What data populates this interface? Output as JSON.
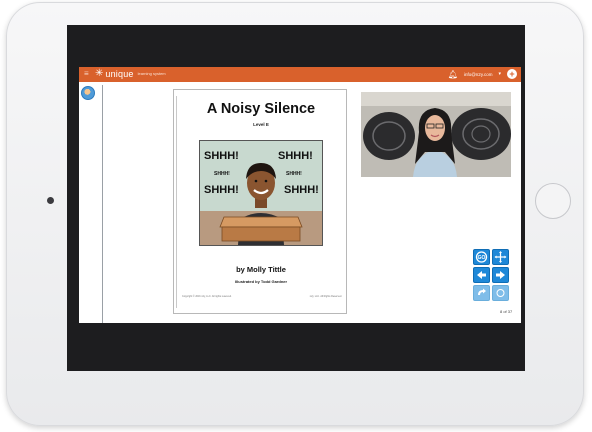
{
  "app": {
    "brand": "unique",
    "brand_sub": "learning system",
    "user_email": "info@n2y.com",
    "colors": {
      "topbar": "#d9612c",
      "control_blue": "#1e88d8"
    }
  },
  "book": {
    "title": "A Noisy Silence",
    "level": "Level E",
    "art_words": [
      "SHHH!",
      "SHHH!",
      "SHHH!",
      "SHHH!",
      "SHHH!",
      "SHHH!"
    ],
    "author": "by Molly Tittle",
    "illustrator": "Illustrated by Todd Gardner",
    "fine_left": "Copyright © 2016 n2y, LLC. All rights reserved.",
    "fine_right": "n2y, LLC. All Rights Reserved."
  },
  "viewer": {
    "page_indicator": "8 of 37"
  },
  "icons": {
    "menu": "menu-icon",
    "bell": "bell-icon",
    "plus": "plus-circle-icon",
    "go": "go-icon",
    "move": "move-icon",
    "prev": "arrow-left-icon",
    "next": "arrow-right-icon",
    "rotate": "rotate-icon",
    "cursor": "cursor-icon"
  }
}
